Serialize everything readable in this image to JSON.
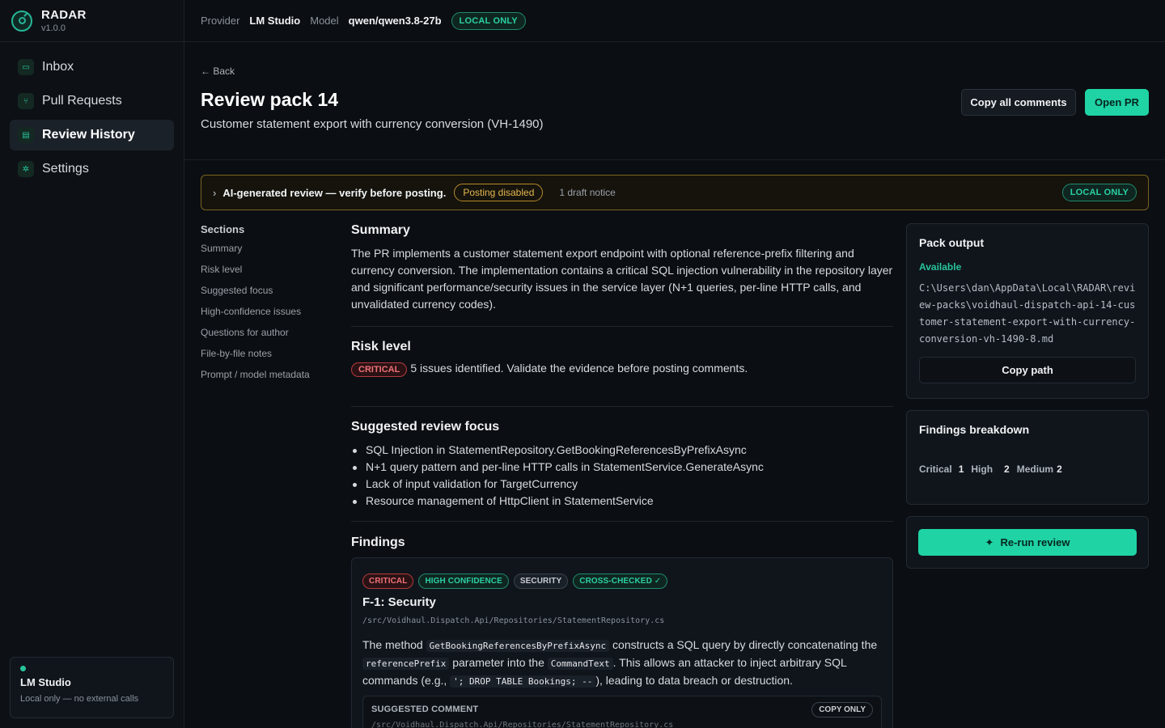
{
  "brand": {
    "name": "RADAR",
    "version": "v1.0.0",
    "logo_icon": "radar-icon"
  },
  "sidebar": {
    "items": [
      {
        "label": "Inbox",
        "icon": "inbox-icon",
        "active": false
      },
      {
        "label": "Pull Requests",
        "icon": "pull-request-icon",
        "active": false
      },
      {
        "label": "Review History",
        "icon": "history-icon",
        "active": true
      },
      {
        "label": "Settings",
        "icon": "gear-icon",
        "active": false
      }
    ],
    "status": {
      "title": "LM Studio",
      "subtitle": "Local only — no external calls",
      "color": "#27c49b"
    }
  },
  "topbar": {
    "provider_label": "Provider",
    "provider_value": "LM Studio",
    "model_label": "Model",
    "model_value": "qwen/qwen3.8-27b",
    "badge": "LOCAL ONLY"
  },
  "header": {
    "back": "← Back",
    "title": "Review pack 14",
    "subtitle": "Customer statement export with currency conversion (VH-1490)",
    "copy_button": "Copy all comments",
    "open_button": "Open PR"
  },
  "banner": {
    "text": "AI-generated review — verify before posting.",
    "status_pill": "Posting disabled",
    "notice": "1 draft notice",
    "badge": "LOCAL ONLY"
  },
  "sections_nav": {
    "title": "Sections",
    "items": [
      "Summary",
      "Risk level",
      "Suggested focus",
      "High-confidence issues",
      "Questions for author",
      "File-by-file notes",
      "Prompt / model metadata"
    ]
  },
  "summary": {
    "heading": "Summary",
    "text": "The PR implements a customer statement export endpoint with optional reference-prefix filtering and currency conversion. The implementation contains a critical SQL injection vulnerability in the repository layer and significant performance/security issues in the service layer (N+1 queries, per-line HTTP calls, and unvalidated currency codes)."
  },
  "risk": {
    "heading": "Risk level",
    "level": "CRITICAL",
    "text": "5 issues identified. Validate the evidence before posting comments."
  },
  "focus": {
    "heading": "Suggested review focus",
    "items": [
      "SQL Injection in StatementRepository.GetBookingReferencesByPrefixAsync",
      "N+1 query pattern and per-line HTTP calls in StatementService.GenerateAsync",
      "Lack of input validation for TargetCurrency",
      "Resource management of HttpClient in StatementService"
    ]
  },
  "findings": {
    "heading": "Findings",
    "items": [
      {
        "tags": [
          "CRITICAL",
          "HIGH CONFIDENCE",
          "SECURITY",
          "CROSS-CHECKED ✓"
        ],
        "title": "F-1: Security",
        "path": "/src/Voidhaul.Dispatch.Api/Repositories/StatementRepository.cs",
        "body_1": "The method",
        "code_1": "GetBookingReferencesByPrefixAsync",
        "body_2": "constructs a SQL query by directly concatenating the",
        "code_2": "referencePrefix",
        "body_3": "parameter into the",
        "code_3": "CommandText",
        "body_4": ". This allows an attacker to inject arbitrary SQL commands (e.g.,",
        "code_4": "'; DROP TABLE Bookings; --",
        "body_5": "), leading to data breach or destruction.",
        "suggested_label": "SUGGESTED COMMENT",
        "suggested_badge": "COPY ONLY",
        "suggested_path": "/src/Voidhaul.Dispatch.Api/Repositories/StatementRepository.cs"
      }
    ]
  },
  "pack_output": {
    "title": "Pack output",
    "status": "Available",
    "path": "C:\\Users\\dan\\AppData\\Local\\RADAR\\review-packs\\voidhaul-dispatch-api-14-customer-statement-export-with-currency-conversion-vh-1490-8.md",
    "copy_button": "Copy path"
  },
  "breakdown": {
    "title": "Findings breakdown",
    "critical_label": "Critical",
    "critical": "1",
    "high_label": "High",
    "high": "2",
    "medium_label": "Medium",
    "medium": "2"
  },
  "rerun": {
    "label": "Re-run review",
    "icon": "sparkle-icon"
  },
  "colors": {
    "accent": "#1fd3a5",
    "critical": "#f07077",
    "warning": "#e5b650",
    "background": "#0b0e12"
  }
}
